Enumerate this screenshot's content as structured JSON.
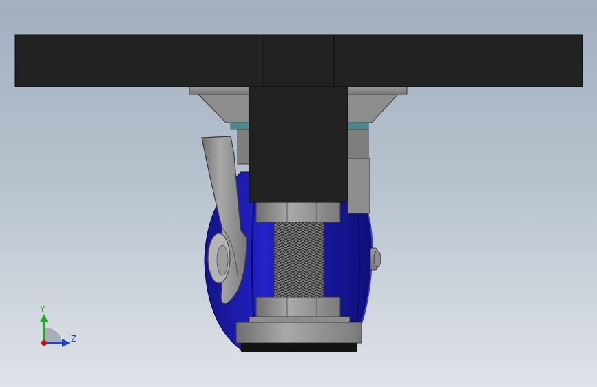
{
  "viewport": {
    "background_top": "#a2afbf",
    "background_bottom": "#dfe3e8"
  },
  "model": {
    "plate_color": "#222222",
    "metal_color": "#8a8a8a",
    "wheel_color": "#1c1cb0",
    "thread_color": "#6a6a6a",
    "pad_color": "#111111"
  },
  "triad": {
    "y_label": "Y",
    "z_label": "Z",
    "y_color": "#22aa22",
    "z_color": "#2244cc",
    "x_color": "#cc1111"
  }
}
